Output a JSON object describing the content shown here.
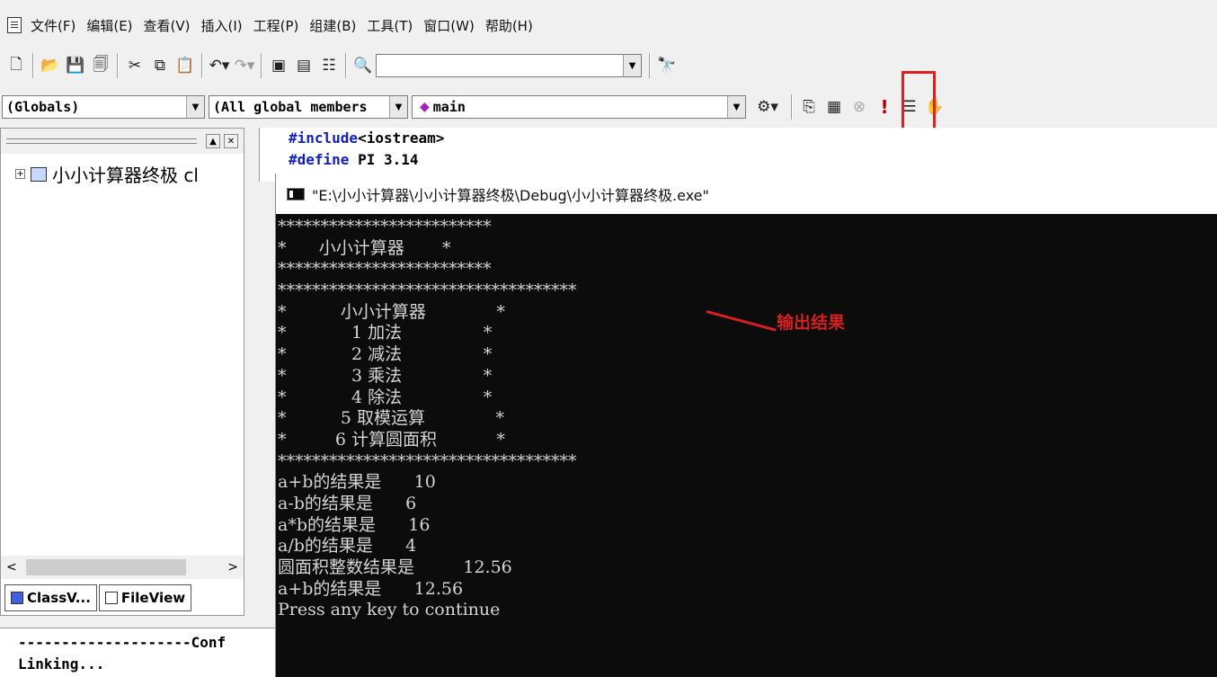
{
  "menu": {
    "items": [
      "文件(F)",
      "编辑(E)",
      "查看(V)",
      "插入(I)",
      "工程(P)",
      "组建(B)",
      "工具(T)",
      "窗口(W)",
      "帮助(H)"
    ]
  },
  "toolbar": {
    "find_combo_value": "",
    "globals_combo": "(Globals)",
    "members_combo": "(All global members",
    "function_combo": "main",
    "execute_icon": "!"
  },
  "workspace": {
    "tree_item": "小小计算器终极 cl",
    "tabs": [
      "ClassV...",
      "FileView"
    ]
  },
  "editor": {
    "lines": [
      {
        "kw": "#include",
        "rest": "<iostream>"
      },
      {
        "kw": "#define",
        "rest": " PI 3.14"
      }
    ]
  },
  "output": {
    "lines": [
      "--------------------Conf",
      "Linking..."
    ]
  },
  "console": {
    "title": "\"E:\\小小计算器\\小小计算器终极\\Debug\\小小计算器终极.exe\"",
    "lines": [
      "*************************",
      "*      小小计算器       *",
      "*************************",
      "***********************************",
      "*          小小计算器             *",
      "*            1 加法               *",
      "*            2 减法               *",
      "*            3 乘法               *",
      "*            4 除法               *",
      "*          5 取模运算             *",
      "*         6 计算圆面积           *",
      "***********************************",
      "a+b的结果是      10",
      "a-b的结果是      6",
      "a*b的结果是      16",
      "a/b的结果是      4",
      "圆面积整数结果是         12.56",
      "a+b的结果是      12.56",
      "Press any key to continue"
    ]
  },
  "annotation": {
    "text": "输出结果",
    "color": "#d62020"
  }
}
